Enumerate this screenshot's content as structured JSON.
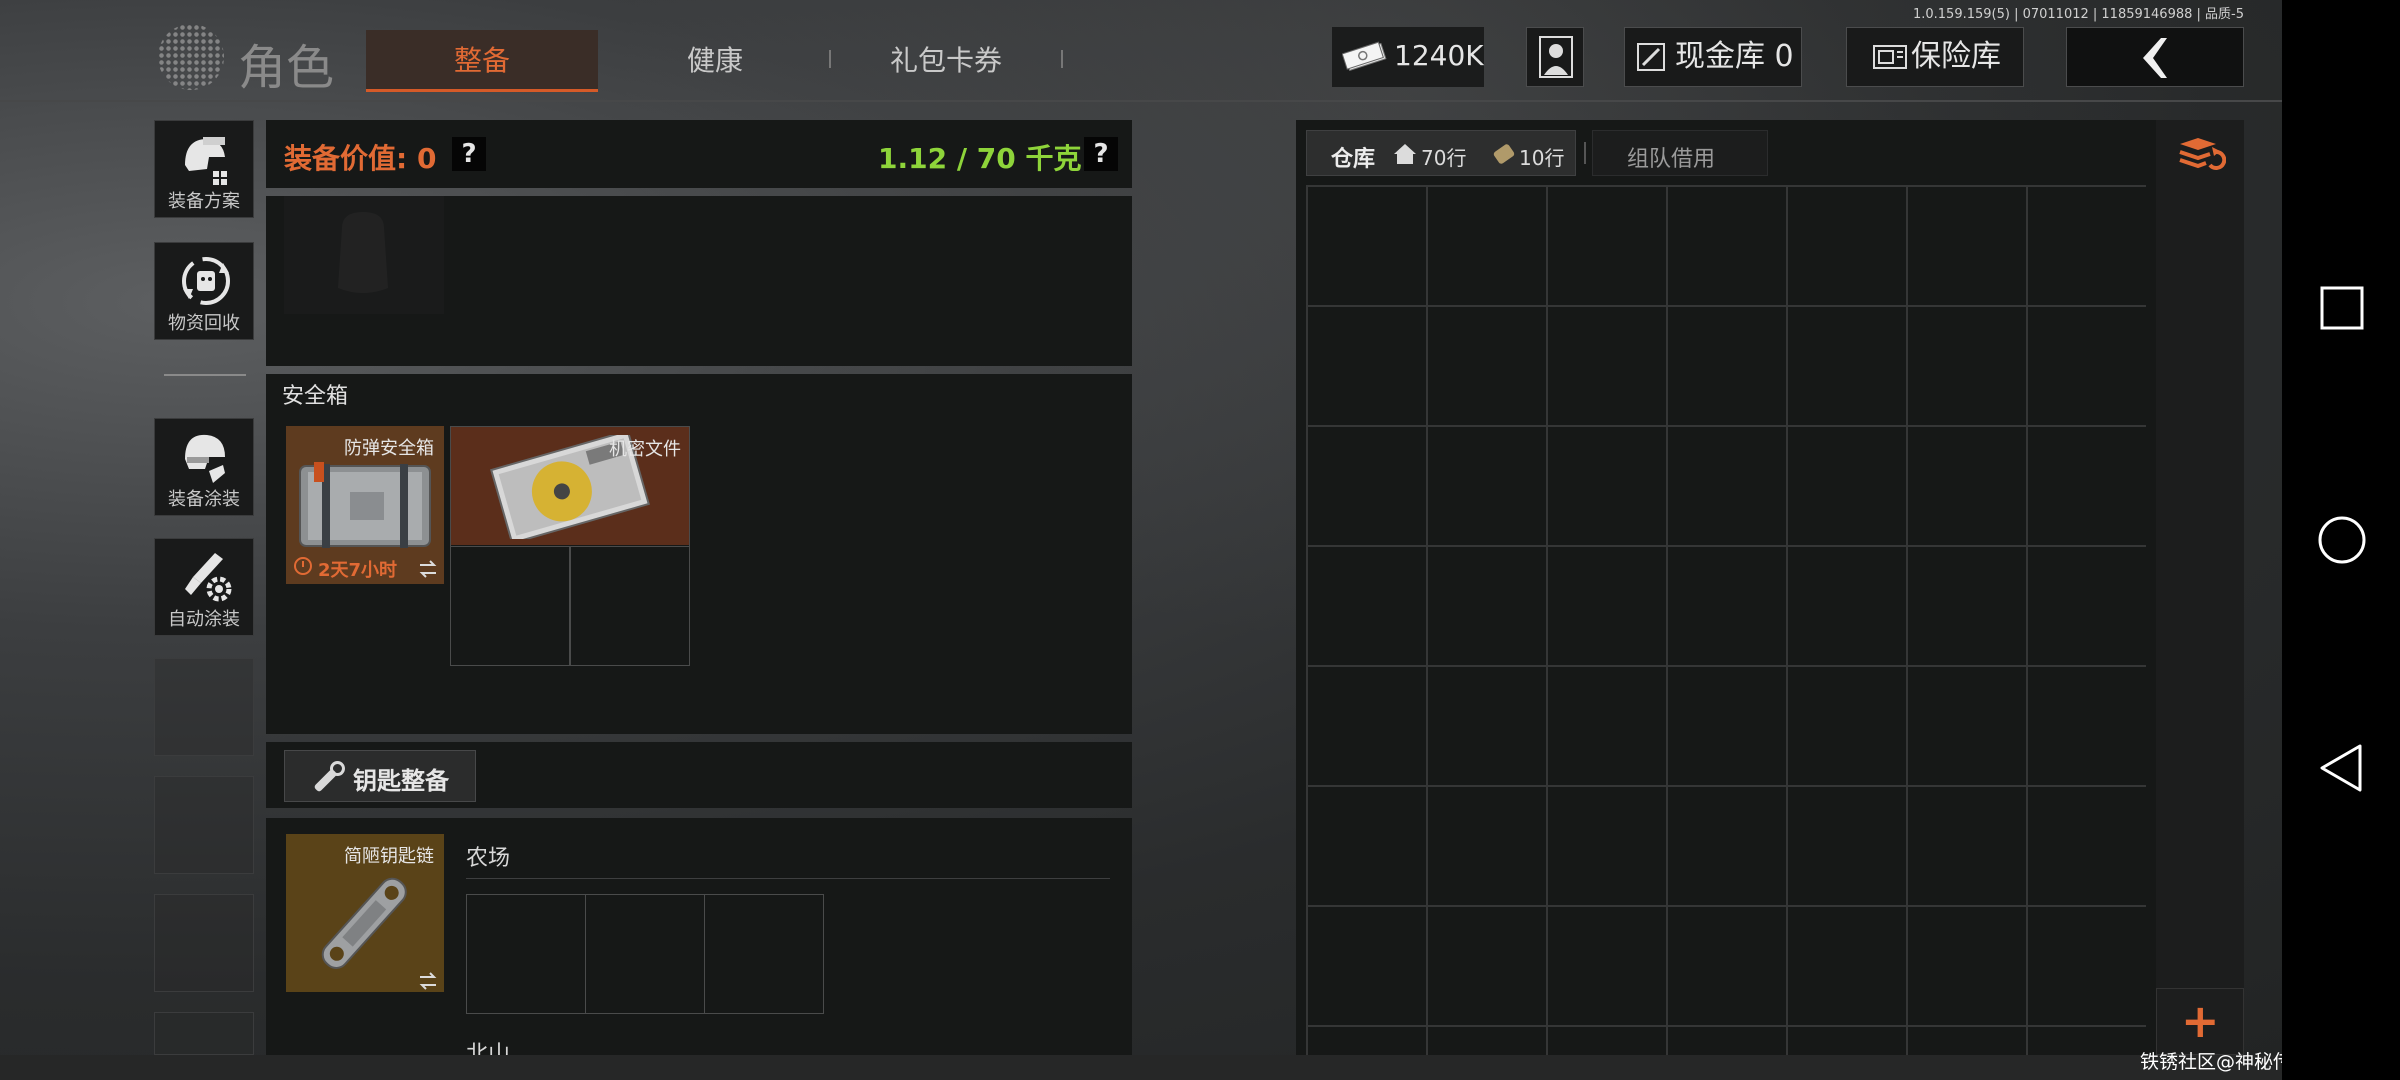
{
  "version": "1.0.159.159(5) | 07011012 | 11859146988 | 品质-5",
  "header": {
    "title": "角色",
    "tabs": [
      {
        "label": "整备",
        "active": true
      },
      {
        "label": "健康",
        "active": false
      },
      {
        "label": "礼包卡券",
        "active": false
      }
    ],
    "money": "1240K",
    "cash_vault": "现金库 0",
    "insurance": "保险库"
  },
  "sidebar": {
    "items": [
      {
        "label": "装备方案",
        "icon": "helmet-gear-icon"
      },
      {
        "label": "物资回收",
        "icon": "recycle-icon"
      },
      {
        "label": "装备涂装",
        "icon": "helmet-paint-icon"
      },
      {
        "label": "自动涂装",
        "icon": "auto-paint-icon"
      }
    ]
  },
  "equipment": {
    "value_label": "装备价值: 0",
    "weight": "1.12 / 70 千克",
    "help": "?"
  },
  "safe_box": {
    "title": "安全箱",
    "item_name": "防弹安全箱",
    "timer": "2天7小时",
    "content_name": "机密文件"
  },
  "keys": {
    "button_label": "钥匙整备",
    "keychain_name": "简陋钥匙链",
    "zones": [
      "农场",
      "北山"
    ]
  },
  "stash": {
    "tab_label": "仓库",
    "rows_home": "70行",
    "rows_extra": "10行",
    "team_tab": "组队借用",
    "add": "+"
  },
  "watermark": "铁锈社区@神秘传奇坐牢王",
  "colors": {
    "accent": "#e16a34",
    "weight_green": "#8ed43a",
    "panel": "#161817"
  }
}
